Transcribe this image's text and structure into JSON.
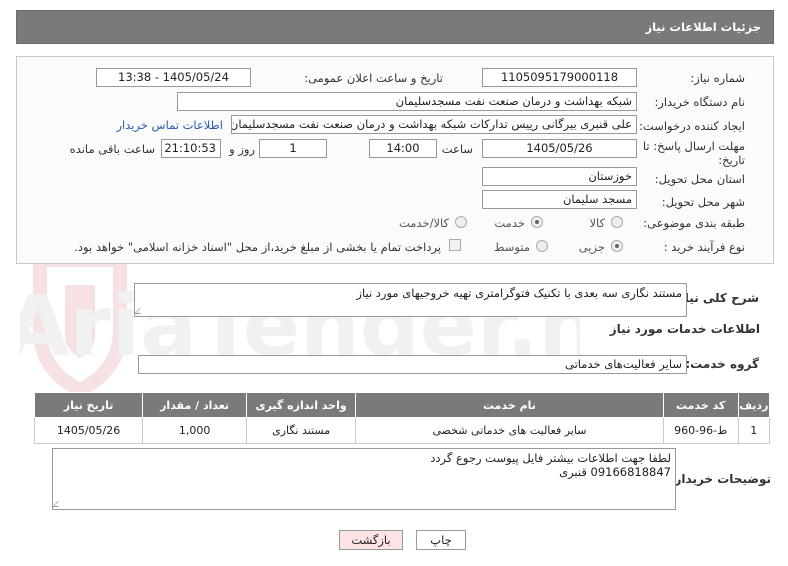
{
  "header": {
    "title": "جزئیات اطلاعات نیاز"
  },
  "form": {
    "need_number_label": "شماره نیاز:",
    "need_number": "1105095179000118",
    "announce_label": "تاریخ و ساعت اعلان عمومی:",
    "announce_value": "1405/05/24 - 13:38",
    "buyer_org_label": "نام دستگاه خریدار:",
    "buyer_org": "شبکه بهداشت و درمان صنعت نفت مسجدسلیمان",
    "creator_label": "ایجاد کننده درخواست:",
    "creator": "علی قنبری بیرگانی رییس تدارکات شبکه بهداشت و درمان صنعت نفت مسجدسلیمان",
    "contact_link": "اطلاعات تماس خریدار",
    "deadline_label_1": "مهلت ارسال پاسخ: تا",
    "deadline_label_2": "تاریخ:",
    "deadline_date": "1405/05/26",
    "time_label": "ساعت",
    "deadline_time": "14:00",
    "days_value": "1",
    "days_label": "روز و",
    "remaining_time": "21:10:53",
    "remaining_label": "ساعت باقی مانده",
    "province_label": "استان محل تحویل:",
    "province": "خوزستان",
    "city_label": "شهر محل تحویل:",
    "city": "مسجد سلیمان",
    "category_label": "طبقه بندی موضوعی:",
    "category_options": [
      "کالا",
      "خدمت",
      "کالا/خدمت"
    ],
    "category_selected": "خدمت",
    "process_label": "نوع فرآیند خرید :",
    "process_options": [
      "جزیی",
      "متوسط"
    ],
    "process_selected": "جزیی",
    "payment_note": "پرداخت تمام یا بخشی از مبلغ خرید،از محل \"اسناد خزانه اسلامی\" خواهد بود."
  },
  "description": {
    "label": "شرح کلی نیاز:",
    "value": "مستند نگاری سه بعدی با تکنیک فتوگرامتری تهیه خروجیهای مورد نیاز"
  },
  "services_title": "اطلاعات خدمات مورد نیاز",
  "service_group": {
    "label": "گروه خدمت:",
    "value": "سایر فعالیت‌های خدماتی"
  },
  "table": {
    "headers": [
      "ردیف",
      "کد خدمت",
      "نام خدمت",
      "واحد اندازه گیری",
      "تعداد / مقدار",
      "تاریخ نیاز"
    ],
    "rows": [
      [
        "1",
        "ط-96-960",
        "سایر فعالیت های خدماتی شخصی",
        "مستند نگاری",
        "1,000",
        "1405/05/26"
      ]
    ]
  },
  "buyer_notes": {
    "label": "توضیحات خریدار:",
    "line1": "لطفا جهت اطلاعات بیشتر فایل پیوست رجوع گردد",
    "line2": "09166818847 قنبری"
  },
  "buttons": {
    "print": "چاپ",
    "back": "بازگشت"
  },
  "watermark": "AriaTender.net",
  "colors": {
    "header_bg": "#7a7a7a",
    "link": "#2a5db0",
    "watermark": "#c0282e"
  }
}
